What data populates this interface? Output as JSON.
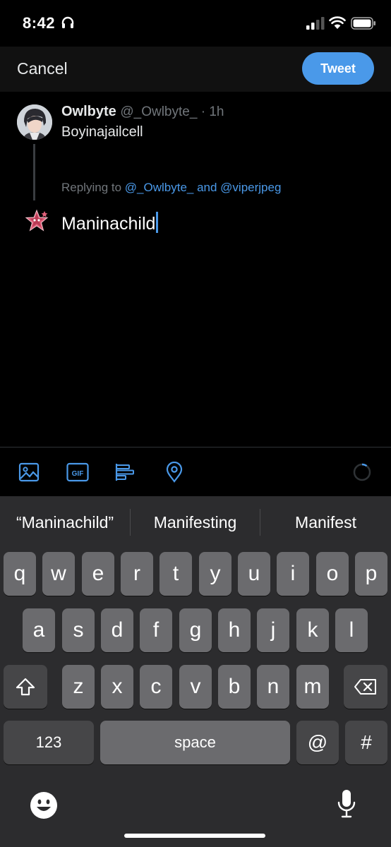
{
  "status_bar": {
    "time": "8:42"
  },
  "header": {
    "cancel_label": "Cancel",
    "tweet_label": "Tweet"
  },
  "original_tweet": {
    "name": "Owlbyte",
    "handle": "@_Owlbyte_",
    "separator": " · ",
    "time": "1h",
    "text": "Boyinajailcell"
  },
  "reply": {
    "replying_prefix": "Replying to ",
    "mention1": "@_Owlbyte_",
    "conjunction": " and ",
    "mention2": "@viperjpeg",
    "draft_text": "Maninachild"
  },
  "toolbar": {
    "gif_label": "GIF"
  },
  "keyboard": {
    "suggestions": [
      "“Maninachild”",
      "Manifesting",
      "Manifest"
    ],
    "row1": [
      "q",
      "w",
      "e",
      "r",
      "t",
      "y",
      "u",
      "i",
      "o",
      "p"
    ],
    "row2": [
      "a",
      "s",
      "d",
      "f",
      "g",
      "h",
      "j",
      "k",
      "l"
    ],
    "row3": [
      "z",
      "x",
      "c",
      "v",
      "b",
      "n",
      "m"
    ],
    "numbers_label": "123",
    "space_label": "space",
    "at_label": "@",
    "hash_label": "#"
  },
  "colors": {
    "accent": "#4a99e9",
    "background": "#000000",
    "keyboard": "#2c2c2e"
  }
}
